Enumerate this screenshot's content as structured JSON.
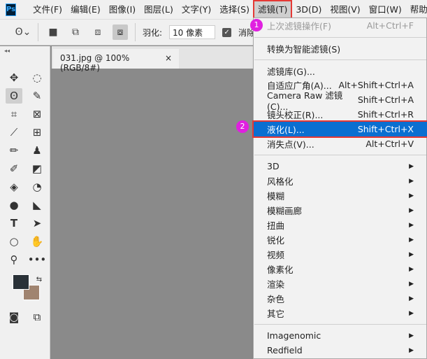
{
  "app": {
    "logo": "Ps"
  },
  "menubar": [
    "文件(F)",
    "编辑(E)",
    "图像(I)",
    "图层(L)",
    "文字(Y)",
    "选择(S)",
    "滤镜(T)",
    "3D(D)",
    "视图(V)",
    "窗口(W)",
    "帮助(H)"
  ],
  "options": {
    "feather_label": "羽化:",
    "feather_value": "10 像素",
    "antialias_label": "消除锯齿"
  },
  "document_tab": {
    "title": "031.jpg @ 100%(RGB/8#)",
    "close": "×"
  },
  "filter_menu": {
    "items": [
      {
        "label": "上次滤镜操作(F)",
        "shortcut": "Alt+Ctrl+F",
        "disabled": true
      },
      {
        "label": "转换为智能滤镜(S)",
        "shortcut": ""
      },
      {
        "label": "滤镜库(G)...",
        "shortcut": ""
      },
      {
        "label": "自适应广角(A)...",
        "shortcut": "Alt+Shift+Ctrl+A"
      },
      {
        "label": "Camera Raw 滤镜(C)...",
        "shortcut": "Shift+Ctrl+A"
      },
      {
        "label": "镜头校正(R)...",
        "shortcut": "Shift+Ctrl+R"
      },
      {
        "label": "液化(L)...",
        "shortcut": "Shift+Ctrl+X",
        "highlighted": true
      },
      {
        "label": "消失点(V)...",
        "shortcut": "Alt+Ctrl+V"
      }
    ],
    "submenus": [
      "3D",
      "风格化",
      "模糊",
      "模糊画廊",
      "扭曲",
      "锐化",
      "视频",
      "像素化",
      "渲染",
      "杂色",
      "其它"
    ],
    "plugins": [
      "Imagenomic",
      "Redfield"
    ]
  },
  "badges": [
    "1",
    "2"
  ],
  "colors": {
    "highlight": "#0a6fd1",
    "annotation": "#e53935",
    "badge": "#e020e0",
    "foreground": "#2a3238",
    "background": "#a08470"
  }
}
